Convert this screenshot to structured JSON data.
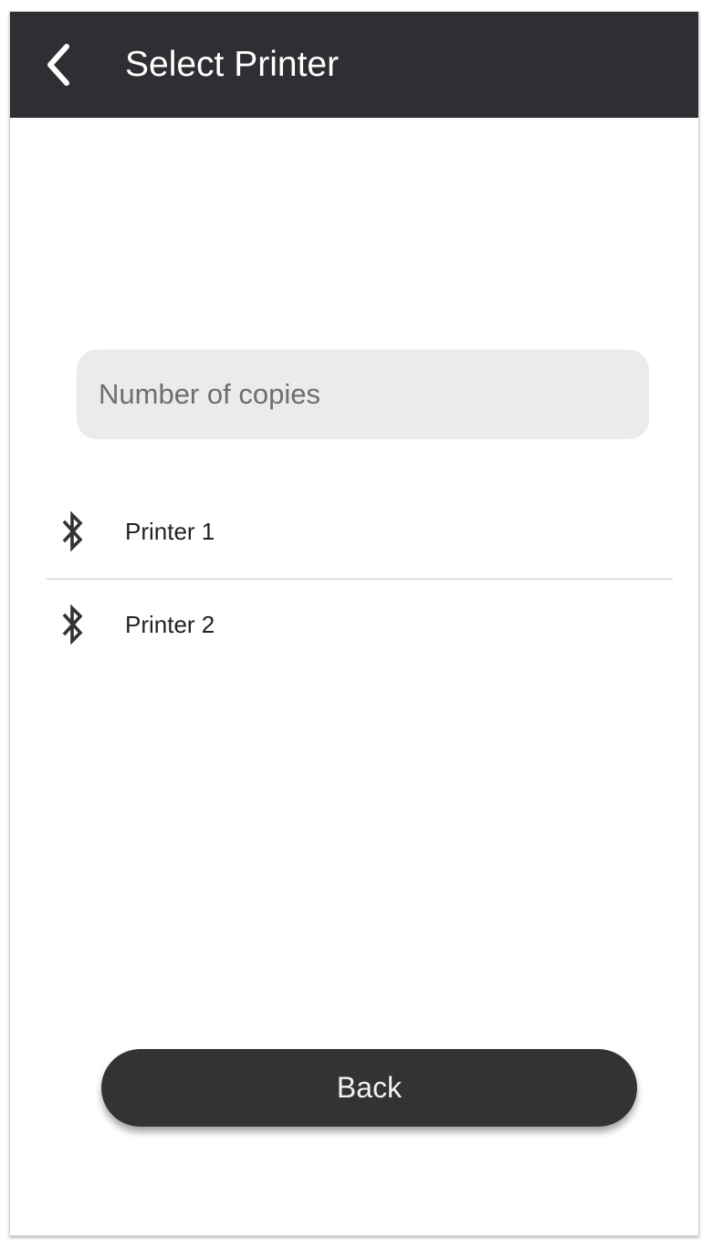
{
  "header": {
    "title": "Select Printer",
    "back_icon": "chevron-left-icon"
  },
  "copies_input": {
    "placeholder": "Number of copies",
    "value": ""
  },
  "printers": [
    {
      "label": "Printer 1",
      "icon": "bluetooth-icon"
    },
    {
      "label": "Printer 2",
      "icon": "bluetooth-icon"
    }
  ],
  "footer": {
    "back_label": "Back"
  },
  "colors": {
    "header_bg": "#2e2f33",
    "input_bg": "#ebebeb",
    "button_bg": "#333333"
  }
}
